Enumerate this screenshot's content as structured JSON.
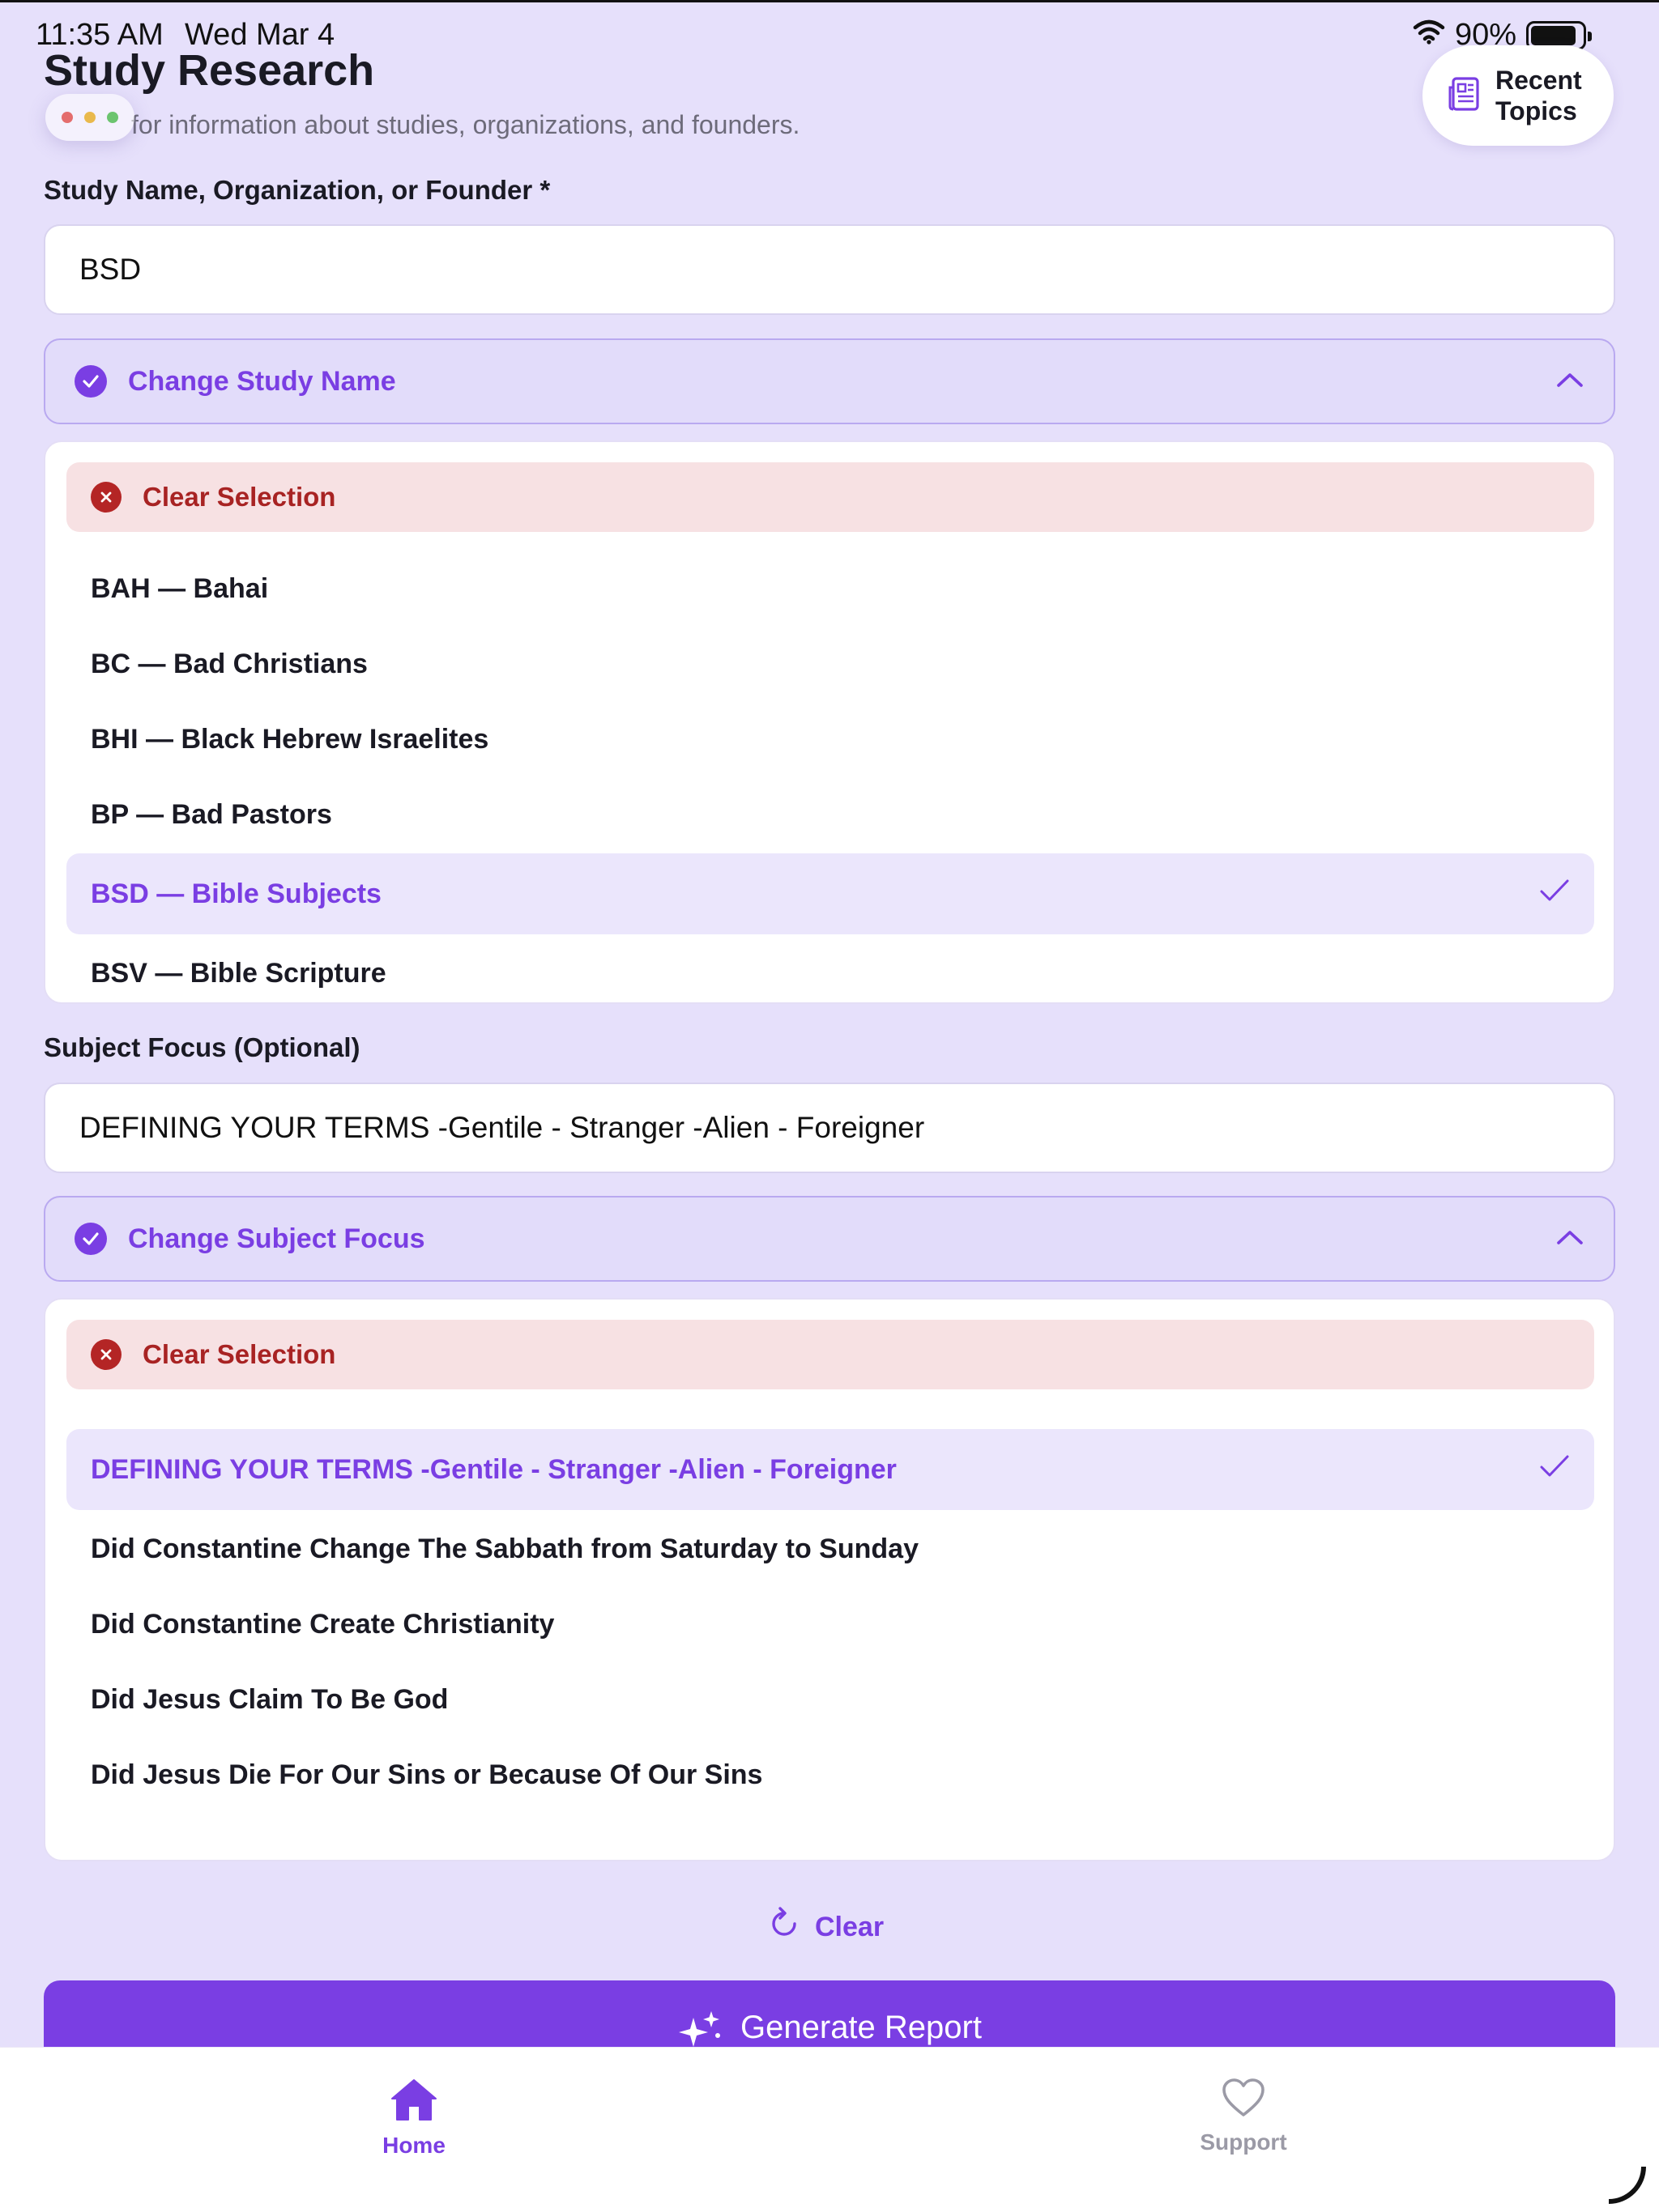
{
  "status_bar": {
    "time": "11:35 AM",
    "date": "Wed Mar 4",
    "battery": "90%"
  },
  "header": {
    "title": "Study Research",
    "subtitle": "for information about studies, organizations, and founders.",
    "recent_topics_line1": "Recent",
    "recent_topics_line2": "Topics",
    "recent_topics_icon": "newspaper-icon"
  },
  "study_field": {
    "label": "Study Name, Organization, or Founder *",
    "value": "BSD",
    "toggle_label": "Change Study Name",
    "clear_label": "Clear Selection",
    "options": [
      {
        "label": "BAH — Bahai",
        "selected": false
      },
      {
        "label": "BC — Bad Christians",
        "selected": false
      },
      {
        "label": "BHI — Black Hebrew Israelites",
        "selected": false
      },
      {
        "label": "BP — Bad Pastors",
        "selected": false
      },
      {
        "label": "BSD — Bible Subjects",
        "selected": true
      },
      {
        "label": "BSV — Bible Scripture",
        "selected": false
      }
    ]
  },
  "subject_field": {
    "label": "Subject Focus (Optional)",
    "value": "DEFINING YOUR TERMS -Gentile - Stranger -Alien - Foreigner",
    "toggle_label": "Change Subject Focus",
    "clear_label": "Clear Selection",
    "options": [
      {
        "label": "DEFINING YOUR TERMS -Gentile - Stranger -Alien - Foreigner",
        "selected": true
      },
      {
        "label": "Did Constantine Change The Sabbath from Saturday to Sunday",
        "selected": false
      },
      {
        "label": "Did Constantine Create Christianity",
        "selected": false
      },
      {
        "label": "Did Jesus Claim To Be God",
        "selected": false
      },
      {
        "label": "Did Jesus Die For Our Sins or Because Of Our Sins",
        "selected": false
      }
    ]
  },
  "actions": {
    "clear_label": "Clear",
    "generate_label": "Generate Report"
  },
  "tabs": [
    {
      "label": "Home",
      "icon": "house-icon",
      "active": true
    },
    {
      "label": "Support",
      "icon": "heart-icon",
      "active": false
    }
  ],
  "colors": {
    "accent": "#7a3ee3",
    "background": "#e6e0fb",
    "danger": "#b42525",
    "danger_bg": "#f7e1e3"
  }
}
